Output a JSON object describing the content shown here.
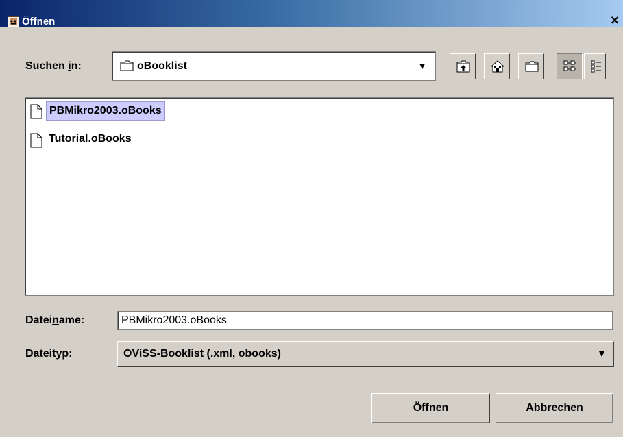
{
  "window": {
    "title": "Öffnen",
    "close_glyph": "×"
  },
  "look_in": {
    "label_prefix": "Suchen ",
    "label_mnemonic": "i",
    "label_suffix": "n:",
    "value": "oBooklist",
    "dropdown_glyph": "▼"
  },
  "toolbar": {
    "buttons": [
      {
        "icon": "up-one-level-icon"
      },
      {
        "icon": "home-icon"
      },
      {
        "icon": "new-folder-icon"
      },
      {
        "icon": "list-view-icon",
        "active": true
      },
      {
        "icon": "details-view-icon"
      }
    ]
  },
  "files": [
    {
      "name": "PBMikro2003.oBooks",
      "selected": true
    },
    {
      "name": "Tutorial.oBooks",
      "selected": false
    }
  ],
  "filename": {
    "label_prefix": "Datei",
    "label_mnemonic": "n",
    "label_suffix": "ame:",
    "value": "PBMikro2003.oBooks"
  },
  "filetype": {
    "label_prefix": "Da",
    "label_mnemonic": "t",
    "label_suffix": "eityp:",
    "value": "OViSS-Booklist (.xml, obooks)",
    "dropdown_glyph": "▼"
  },
  "buttons": {
    "open": "Öffnen",
    "cancel": "Abbrechen"
  },
  "colors": {
    "title_bar_start": "#0a246a",
    "title_bar_end": "#a6caf0",
    "selection": "#ccccff",
    "face": "#d4d0c8"
  }
}
